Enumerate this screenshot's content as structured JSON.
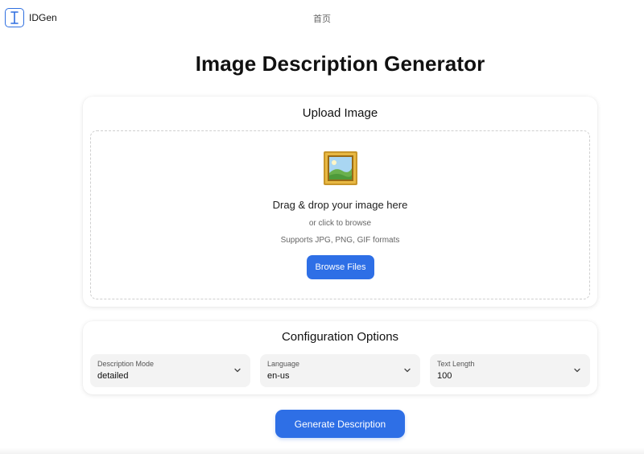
{
  "header": {
    "brand_name": "IDGen",
    "nav_home": "首页"
  },
  "page_title": "Image Description Generator",
  "upload": {
    "title": "Upload Image",
    "drop_text": "Drag & drop your image here",
    "browse_text": "or click to browse",
    "formats_text": "Supports JPG, PNG, GIF formats",
    "browse_button": "Browse Files",
    "icon": "framed-picture-icon"
  },
  "config": {
    "title": "Configuration Options",
    "description_mode": {
      "label": "Description Mode",
      "value": "detailed"
    },
    "language": {
      "label": "Language",
      "value": "en-us"
    },
    "text_length": {
      "label": "Text Length",
      "value": "100"
    }
  },
  "generate_button": "Generate Description",
  "colors": {
    "accent": "#2e6fe6",
    "select_bg": "#f3f3f3",
    "dashed_border": "#cfcfcf"
  }
}
